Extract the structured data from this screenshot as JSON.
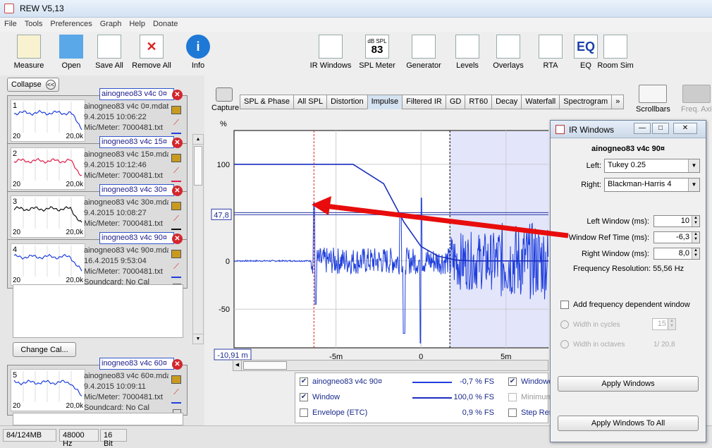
{
  "window": {
    "title": "REW V5,13"
  },
  "menu": [
    "File",
    "Tools",
    "Preferences",
    "Graph",
    "Help",
    "Donate"
  ],
  "toolbar": {
    "left": [
      {
        "label": "Measure",
        "icon": "measure-icon"
      },
      {
        "label": "Open",
        "icon": "folder-icon"
      },
      {
        "label": "Save All",
        "icon": "save-icon"
      },
      {
        "label": "Remove All",
        "icon": "remove-icon"
      },
      {
        "label": "Info",
        "icon": "info-icon"
      }
    ],
    "right": [
      {
        "label": "IR Windows",
        "icon": "ir-windows-icon"
      },
      {
        "label": "SPL Meter",
        "icon": "spl-meter-icon",
        "glyph_top": "dB SPL",
        "glyph": "83"
      },
      {
        "label": "Generator",
        "icon": "generator-icon"
      },
      {
        "label": "Levels",
        "icon": "levels-icon"
      },
      {
        "label": "Overlays",
        "icon": "overlays-icon"
      },
      {
        "label": "RTA",
        "icon": "rta-icon"
      },
      {
        "label": "EQ",
        "icon": "eq-icon",
        "glyph": "EQ"
      },
      {
        "label": "Room Sim",
        "icon": "room-sim-icon"
      }
    ]
  },
  "left_panel": {
    "collapse_label": "Collapse",
    "collapse_glyph": "<<",
    "measurements": [
      {
        "num": "1",
        "name": "ainogneo83 v4c 0¤",
        "file": "ainogneo83 v4c 0¤.mdat",
        "date": "9.4.2015 10:06:22",
        "mic": "Mic/Meter: 7000481.txt",
        "color": "#1f3fdc",
        "x0": "20",
        "x1": "20,0k"
      },
      {
        "num": "2",
        "name": "inogneo83 v4c 15¤",
        "file": "ainogneo83 v4c 15¤.mdat",
        "date": "9.4.2015 10:12:46",
        "mic": "Mic/Meter: 7000481.txt",
        "color": "#e0204a",
        "x0": "20",
        "x1": "20,0k"
      },
      {
        "num": "3",
        "name": "inogneo83 v4c 30¤",
        "file": "ainogneo83 v4c 30¤.mdat",
        "date": "9.4.2015 10:08:27",
        "mic": "Mic/Meter: 7000481.txt",
        "color": "#111111",
        "x0": "20",
        "x1": "20,0k"
      },
      {
        "num": "4",
        "name": "inogneo83 v4c 90¤",
        "file": "ainogneo83 v4c 90¤.mdat",
        "date": "16.4.2015 9:53:04",
        "mic": "Mic/Meter: 7000481.txt",
        "soundcard": "Soundcard: No Cal",
        "color": "#1f3fdc",
        "x0": "20",
        "x1": "20,0k"
      },
      {
        "num": "5",
        "name": "inogneo83 v4c 60¤",
        "file": "ainogneo83 v4c 60¤.mdat",
        "date": "9.4.2015 10:09:11",
        "mic": "Mic/Meter: 7000481.txt",
        "soundcard": "Soundcard: No Cal",
        "color": "#1f3fdc",
        "x0": "20",
        "x1": "20,0k"
      }
    ],
    "change_cal_label": "Change Cal..."
  },
  "status": {
    "memory": "84/124MB",
    "rate": "48000 Hz",
    "bits": "16 Bit"
  },
  "graph": {
    "capture_label": "Capture",
    "tabs": [
      "SPL & Phase",
      "All SPL",
      "Distortion",
      "Impulse",
      "Filtered IR",
      "GD",
      "RT60",
      "Decay",
      "Waterfall",
      "Spectrogram",
      "»"
    ],
    "selected_tab": "Impulse",
    "scrollbars_label": "Scrollbars",
    "freq_axis_label": "Freq. Axi",
    "y_unit": "%",
    "cursor_y": "47,8",
    "cursor_x": "-10,91 m"
  },
  "chart_data": {
    "type": "line",
    "ylabel": "%",
    "y_ticks": [
      "100",
      "50",
      "0",
      "-50"
    ],
    "x_ticks": [
      "-5m",
      "0",
      "5m"
    ],
    "xlim": [
      -11,
      7.5
    ],
    "ylim": [
      -90,
      135
    ],
    "window_left_ms": 10,
    "window_ref_ms": -6.3,
    "window_right_ms": 8.0,
    "series": [
      {
        "name": "ainogneo83 v4c 90¤",
        "color": "#1f3fdc"
      },
      {
        "name": "Window",
        "color": "#1a2dbf",
        "x": [
          -11,
          -4.0,
          -2.2,
          -1.0,
          0.0,
          1.0,
          2.0,
          3.0
        ],
        "y": [
          100,
          100,
          80,
          40,
          15,
          5,
          1,
          0
        ]
      }
    ]
  },
  "legend": [
    {
      "checked": true,
      "name": "ainogneo83 v4c 90¤",
      "value": "-0,7 % FS",
      "line_color": "#1f3fdc",
      "right_checked": true,
      "right_name": "Windowed",
      "right_disabled": false
    },
    {
      "checked": true,
      "name": "Window",
      "value": "100,0 % FS",
      "line_color": "#1a2dbf",
      "right_checked": false,
      "right_name": "Minimum",
      "right_disabled": true
    },
    {
      "checked": false,
      "name": "Envelope (ETC)",
      "value": "0,9 % FS",
      "line_color": "",
      "right_checked": false,
      "right_name": "Step Res",
      "right_disabled": false
    }
  ],
  "ir_dialog": {
    "title": "IR Windows",
    "measurement": "ainogneo83 v4c 90¤",
    "left_label": "Left:",
    "left_value": "Tukey 0.25",
    "right_label": "Right:",
    "right_value": "Blackman-Harris 4",
    "left_window_label": "Left Window (ms):",
    "left_window_value": "10",
    "ref_time_label": "Window Ref Time (ms):",
    "ref_time_value": "-6,3",
    "right_window_label": "Right Window (ms):",
    "right_window_value": "8,0",
    "freq_res_label": "Frequency Resolution:",
    "freq_res_value": "55,56 Hz",
    "fdw_label": "Add frequency dependent window",
    "cycles_label": "Width in cycles",
    "cycles_value": "15",
    "octaves_label": "Width in octaves",
    "octaves_value": "1/ 20,8",
    "apply_label": "Apply Windows",
    "apply_all_label": "Apply Windows To All"
  }
}
